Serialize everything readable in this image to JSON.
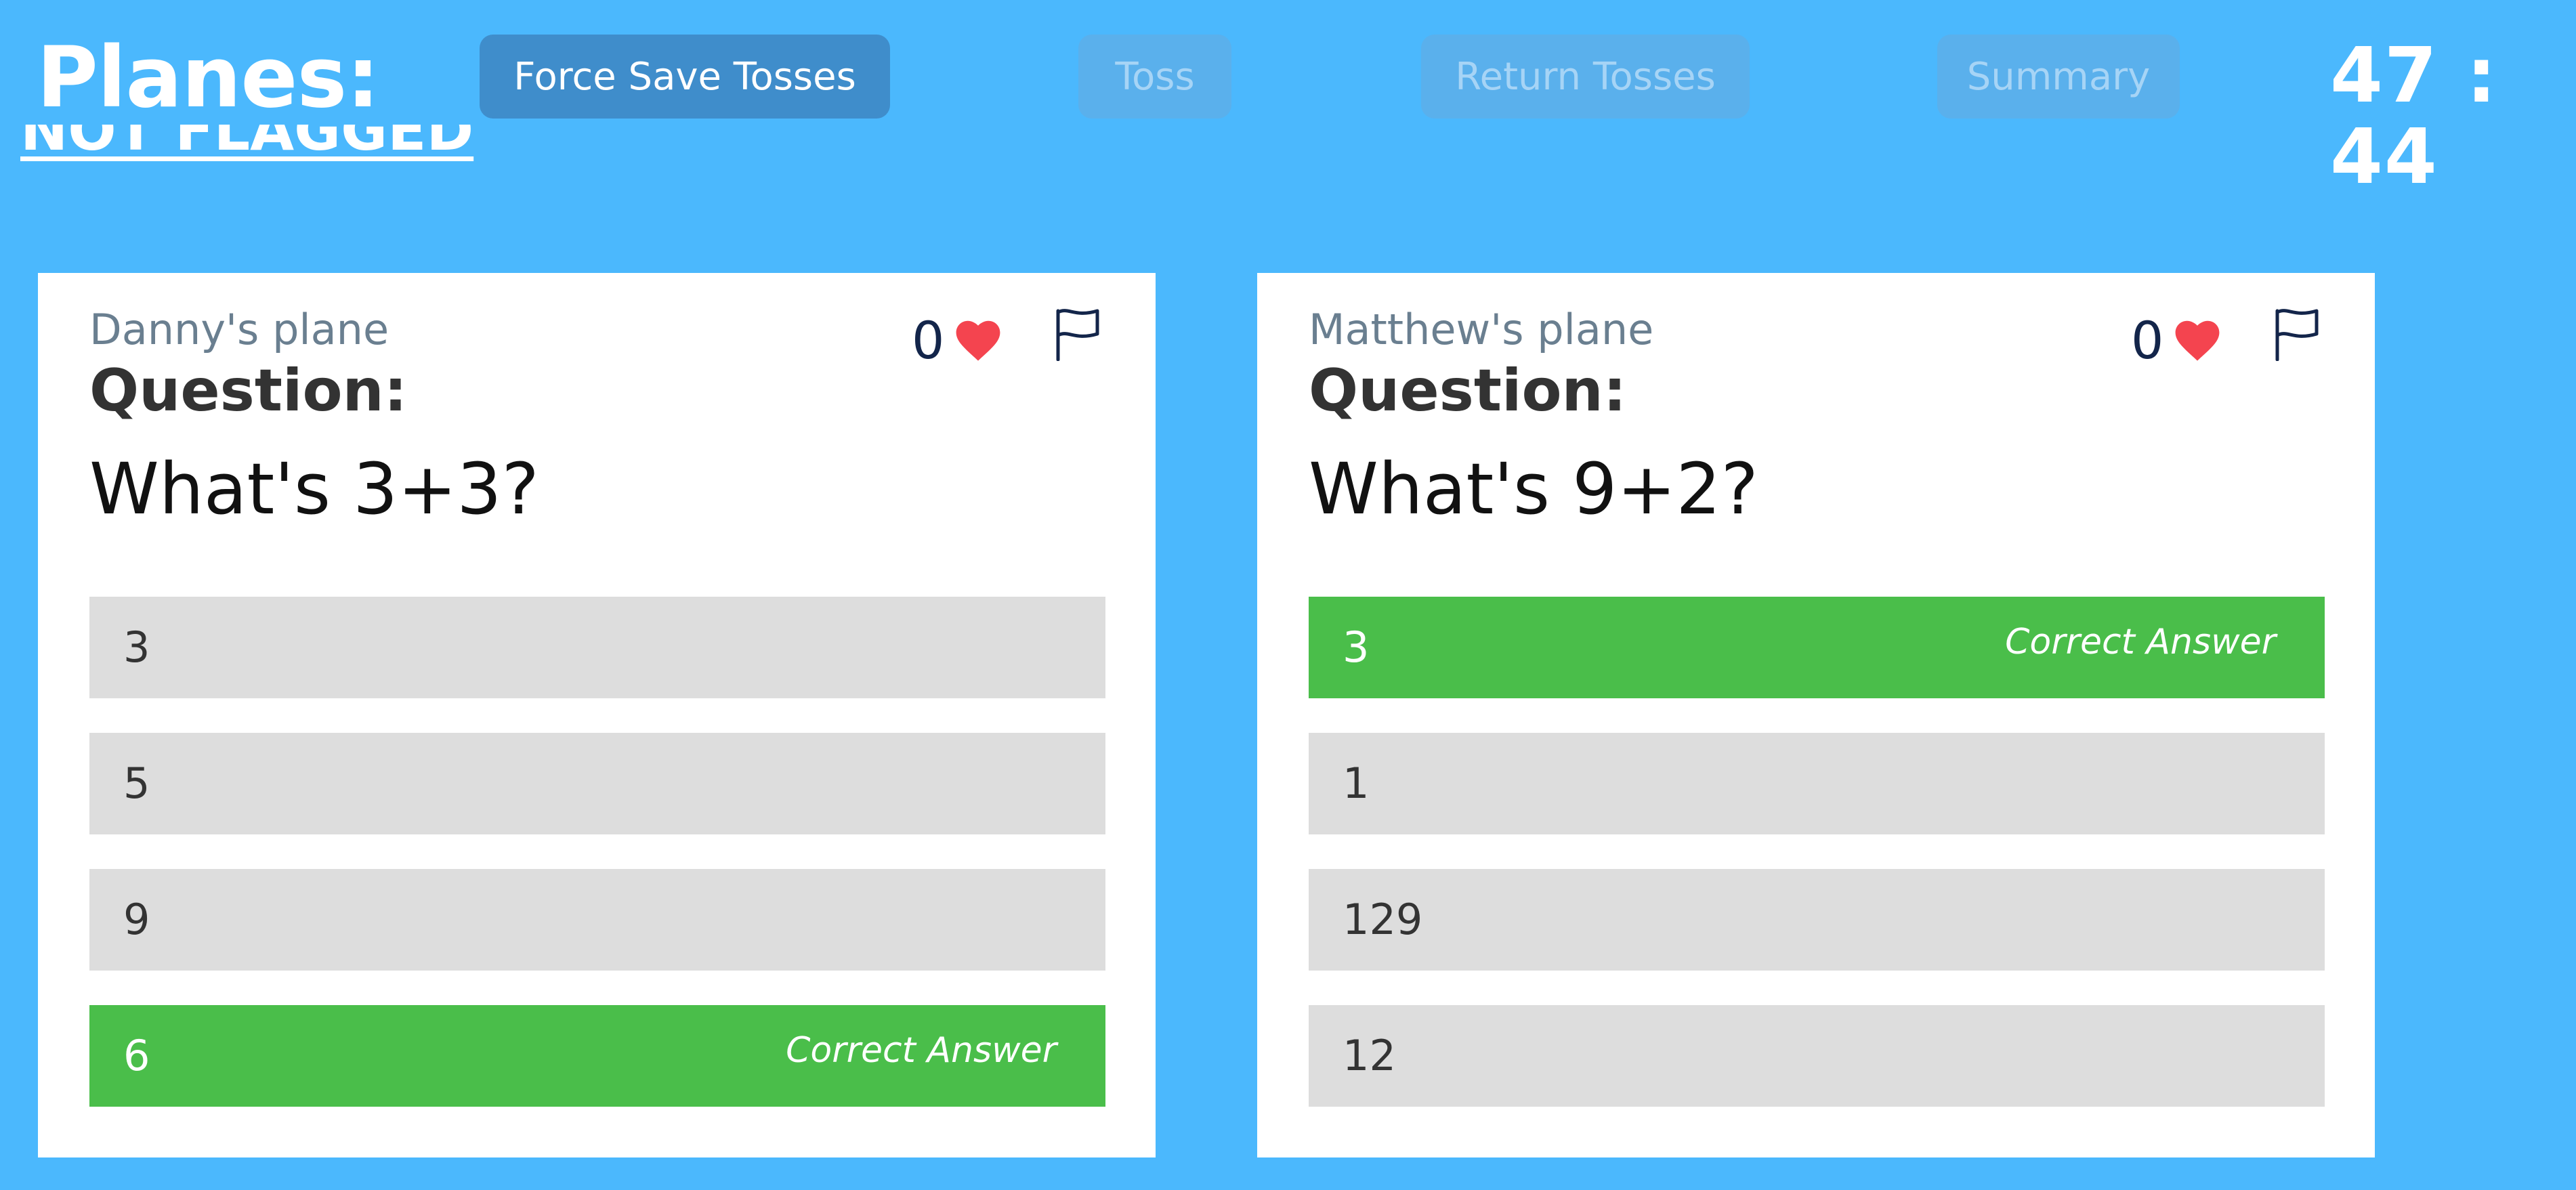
{
  "header": {
    "title": "Planes:",
    "buttons": {
      "force_save": "Force Save Tosses",
      "toss": "Toss",
      "return_tosses": "Return Tosses",
      "summary": "Summary"
    },
    "timer": "47 : 44",
    "filter_link": "NOT FLAGGED"
  },
  "colors": {
    "background": "#4bb8fd",
    "correct": "#4abe4a",
    "answer": "#dddddd",
    "heart": "#f4444f"
  },
  "planes": [
    {
      "owner": "Danny's plane",
      "question_label": "Question:",
      "question": "What's 3+3?",
      "likes": "0",
      "answers": [
        {
          "value": "3",
          "tag": ""
        },
        {
          "value": "5",
          "tag": ""
        },
        {
          "value": "9",
          "tag": ""
        },
        {
          "value": "6",
          "tag": "Correct Answer"
        }
      ]
    },
    {
      "owner": "Matthew's plane",
      "question_label": "Question:",
      "question": "What's 9+2?",
      "likes": "0",
      "answers": [
        {
          "value": "3",
          "tag": "Correct Answer"
        },
        {
          "value": "1",
          "tag": ""
        },
        {
          "value": "129",
          "tag": ""
        },
        {
          "value": "12",
          "tag": ""
        }
      ]
    }
  ]
}
